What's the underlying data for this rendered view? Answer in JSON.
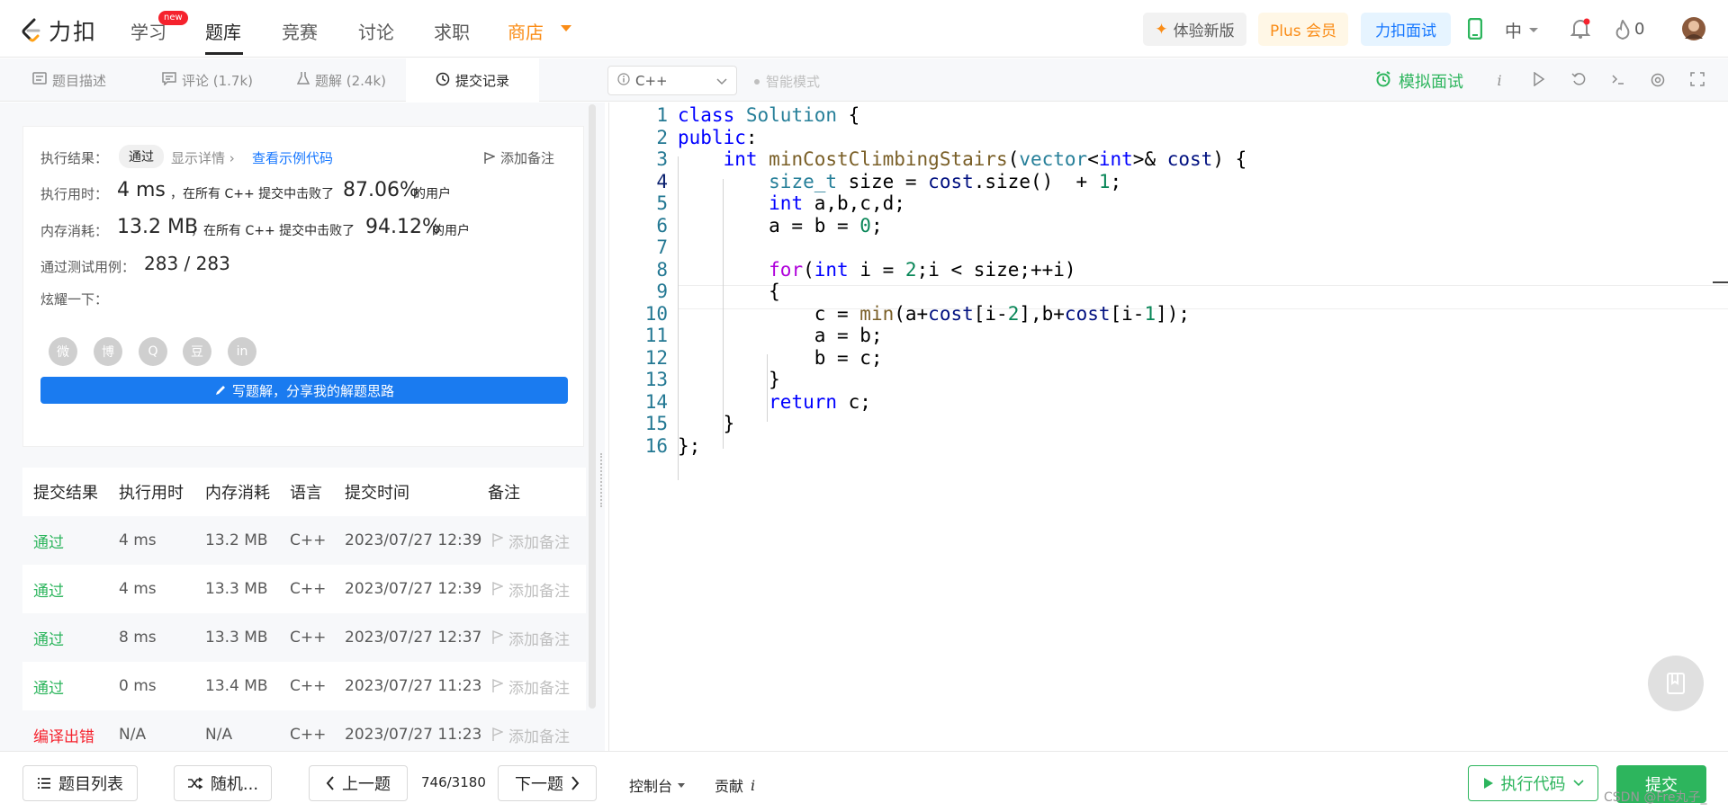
{
  "nav": {
    "logo_text": "力扣",
    "items": [
      "学习",
      "题库",
      "竞赛",
      "讨论",
      "求职",
      "商店"
    ],
    "new_badge": "new",
    "try_new": "体验新版",
    "plus": "Plus 会员",
    "interview": "力扣面试",
    "lang": "中",
    "points": "0"
  },
  "tabs": [
    "题目描述",
    "评论 (1.7k)",
    "题解 (2.4k)",
    "提交记录"
  ],
  "editor_bar": {
    "language": "C++",
    "smart_mode": "智能模式",
    "mock_interview": "模拟面试"
  },
  "result": {
    "result_label": "执行结果：",
    "status": "通过",
    "show_details": "显示详情 ›",
    "view_sample": "查看示例代码",
    "add_note": "添加备注",
    "time_label": "执行用时：",
    "time_value": "4 ms",
    "time_mid": "，在所有 C++ 提交中击败了",
    "time_pct": "87.06%",
    "users": "的用户",
    "mem_label": "内存消耗：",
    "mem_value": "13.2 MB",
    "mem_mid": "，在所有 C++ 提交中击败了",
    "mem_pct": "94.12%",
    "tests_label": "通过测试用例：",
    "tests_value": "283 / 283",
    "share_label": "炫耀一下：",
    "share_icons": [
      "微",
      "博",
      "Q",
      "豆",
      "in"
    ],
    "write_btn": "写题解，分享我的解题思路"
  },
  "table": {
    "headers": [
      "提交结果",
      "执行用时",
      "内存消耗",
      "语言",
      "提交时间",
      "备注"
    ],
    "rows": [
      [
        "通过",
        "4 ms",
        "13.2 MB",
        "C++",
        "2023/07/27 12:39",
        "添加备注"
      ],
      [
        "通过",
        "4 ms",
        "13.3 MB",
        "C++",
        "2023/07/27 12:39",
        "添加备注"
      ],
      [
        "通过",
        "8 ms",
        "13.3 MB",
        "C++",
        "2023/07/27 12:37",
        "添加备注"
      ],
      [
        "通过",
        "0 ms",
        "13.4 MB",
        "C++",
        "2023/07/27 11:23",
        "添加备注"
      ],
      [
        "编译出错",
        "N/A",
        "N/A",
        "C++",
        "2023/07/27 11:23",
        "添加备注"
      ]
    ]
  },
  "code": [
    "class Solution {",
    "public:",
    "    int minCostClimbingStairs(vector<int>& cost) {",
    "        size_t size = cost.size()  + 1;",
    "        int a,b,c,d;",
    "        a = b = 0;",
    "",
    "        for(int i = 2;i < size;++i)",
    "        {",
    "            c = min(a+cost[i-2],b+cost[i-1]);",
    "            a = b;",
    "            b = c;",
    "        }",
    "        return c;",
    "    }",
    "};"
  ],
  "footer": {
    "problem_list": "题目列表",
    "random": "随机...",
    "prev": "上一题",
    "progress": "746/3180",
    "next": "下一题",
    "console": "控制台",
    "contribute": "贡献",
    "run": "执行代码",
    "submit": "提交"
  },
  "watermark": "CSDN @Fre丸子_"
}
